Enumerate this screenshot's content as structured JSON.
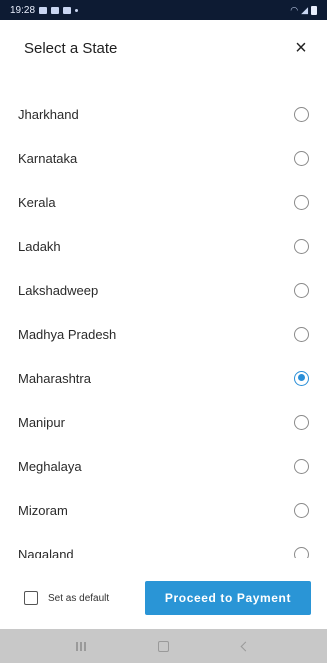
{
  "status_bar": {
    "time": "19:28",
    "left_icons": [
      "gallery-icon",
      "camera-icon",
      "chat-icon",
      "dot-icon"
    ],
    "right_icons": [
      "wifi-icon",
      "signal-icon",
      "battery-icon"
    ]
  },
  "header": {
    "title": "Select a State",
    "close_label": "×"
  },
  "states": [
    {
      "label": "Jharkhand",
      "selected": false
    },
    {
      "label": "Karnataka",
      "selected": false
    },
    {
      "label": "Kerala",
      "selected": false
    },
    {
      "label": "Ladakh",
      "selected": false
    },
    {
      "label": "Lakshadweep",
      "selected": false
    },
    {
      "label": "Madhya Pradesh",
      "selected": false
    },
    {
      "label": "Maharashtra",
      "selected": true
    },
    {
      "label": "Manipur",
      "selected": false
    },
    {
      "label": "Meghalaya",
      "selected": false
    },
    {
      "label": "Mizoram",
      "selected": false
    },
    {
      "label": "Nagaland",
      "selected": false
    }
  ],
  "footer": {
    "default_checkbox_label": "Set as default",
    "default_checked": false,
    "pay_button_label": "Proceed to Payment"
  },
  "colors": {
    "accent": "#2a95d6",
    "status_bar": "#0d1b33",
    "nav_bar": "#c8c8c8"
  }
}
